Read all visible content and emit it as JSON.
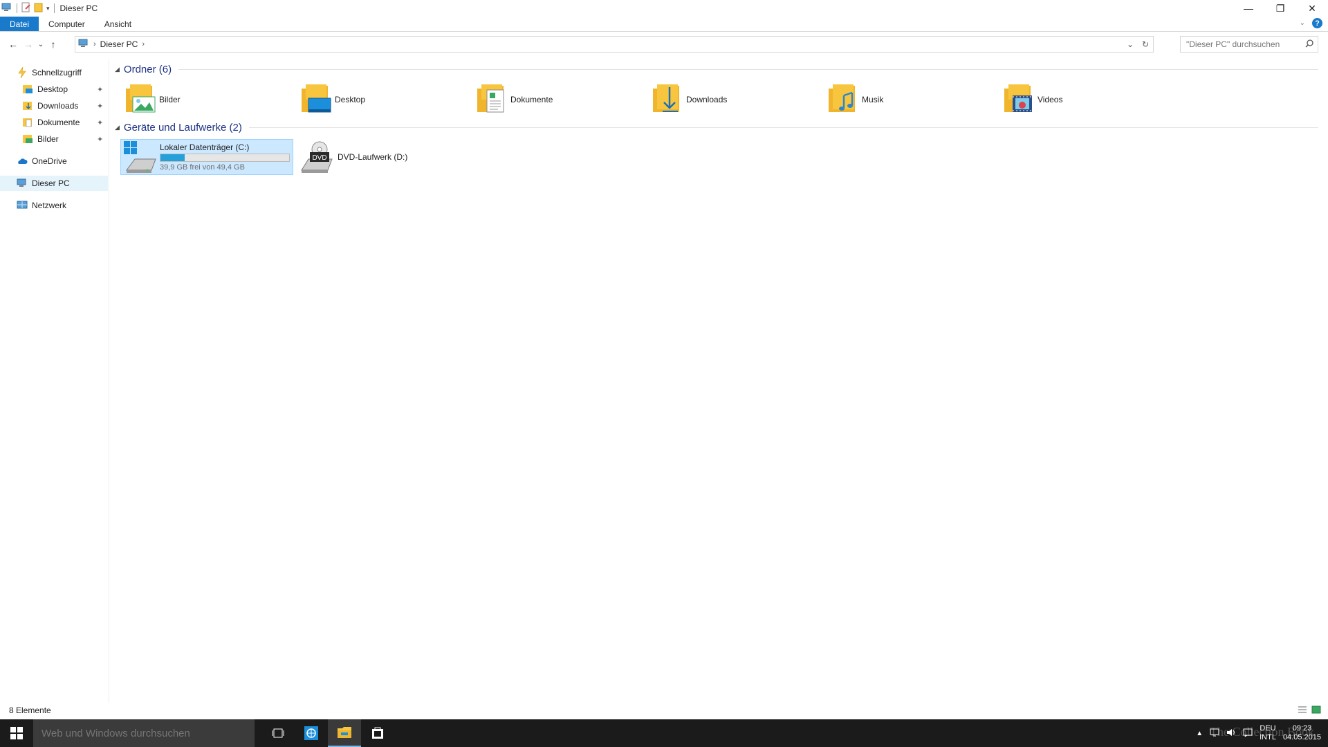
{
  "window": {
    "title": "Dieser PC",
    "controls": {
      "minimize": "—",
      "maximize": "❐",
      "close": "✕"
    }
  },
  "ribbon": {
    "tabs": [
      "Datei",
      "Computer",
      "Ansicht"
    ],
    "help": "?"
  },
  "navigation": {
    "back": "←",
    "forward": "→",
    "recent": "⌄",
    "up": "↑",
    "breadcrumb": [
      "Dieser PC"
    ],
    "search_placeholder": "\"Dieser PC\" durchsuchen"
  },
  "sidebar": {
    "items": [
      {
        "label": "Schnellzugriff",
        "icon": "quick-access-icon",
        "pinned": false
      },
      {
        "label": "Desktop",
        "icon": "desktop-folder-icon",
        "pinned": true
      },
      {
        "label": "Downloads",
        "icon": "downloads-folder-icon",
        "pinned": true
      },
      {
        "label": "Dokumente",
        "icon": "documents-folder-icon",
        "pinned": true
      },
      {
        "label": "Bilder",
        "icon": "pictures-folder-icon",
        "pinned": true
      },
      {
        "label": "OneDrive",
        "icon": "onedrive-icon",
        "pinned": false
      },
      {
        "label": "Dieser PC",
        "icon": "this-pc-icon",
        "pinned": false,
        "selected": true
      },
      {
        "label": "Netzwerk",
        "icon": "network-icon",
        "pinned": false
      }
    ],
    "pin_glyph": "📌"
  },
  "content": {
    "folders_group": {
      "label": "Ordner (6)",
      "items": [
        {
          "name": "Bilder",
          "icon": "pictures-folder-icon"
        },
        {
          "name": "Desktop",
          "icon": "desktop-folder-icon"
        },
        {
          "name": "Dokumente",
          "icon": "documents-folder-icon"
        },
        {
          "name": "Downloads",
          "icon": "downloads-folder-icon"
        },
        {
          "name": "Musik",
          "icon": "music-folder-icon"
        },
        {
          "name": "Videos",
          "icon": "videos-folder-icon"
        }
      ]
    },
    "drives_group": {
      "label": "Geräte und Laufwerke (2)",
      "items": [
        {
          "name": "Lokaler Datenträger (C:)",
          "free_text": "39,9 GB frei von 49,4 GB",
          "used_fraction": 0.19,
          "icon": "system-drive-icon",
          "selected": true
        },
        {
          "name": "DVD-Laufwerk (D:)",
          "icon": "dvd-drive-icon",
          "badge": "DVD"
        }
      ]
    }
  },
  "status": {
    "count": "8 Elemente"
  },
  "taskbar": {
    "search_placeholder": "Web und Windows durchsuchen",
    "language": [
      "DEU",
      "INTL"
    ],
    "time": "09:23",
    "date": "04.05.2015",
    "watermark": "The Collection Book"
  },
  "colors": {
    "accent": "#1979ca",
    "folder": "#f8c63e",
    "selection": "#cce8ff",
    "drive_bar": "#26a0da",
    "taskbar": "#1b1b1b"
  }
}
